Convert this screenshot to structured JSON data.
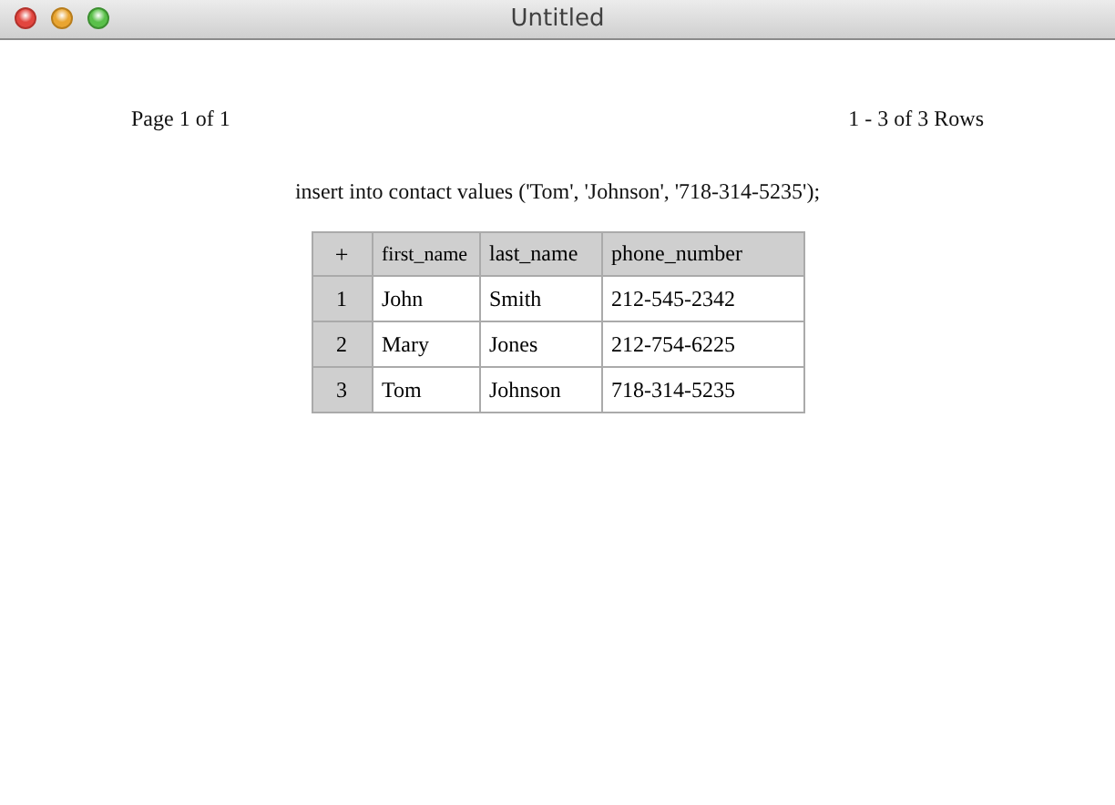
{
  "window": {
    "title": "Untitled"
  },
  "pager": {
    "page": "Page 1 of 1",
    "rows": "1 - 3 of 3 Rows"
  },
  "query": "insert into contact values ('Tom', 'Johnson', '718-314-5235');",
  "table": {
    "add": "+",
    "columns": [
      "first_name",
      "last_name",
      "phone_number"
    ],
    "rows": [
      {
        "index": "1",
        "cells": [
          "John",
          "Smith",
          "212-545-2342"
        ]
      },
      {
        "index": "2",
        "cells": [
          "Mary",
          "Jones",
          "212-754-6225"
        ]
      },
      {
        "index": "3",
        "cells": [
          "Tom",
          "Johnson",
          "718-314-5235"
        ]
      }
    ]
  }
}
